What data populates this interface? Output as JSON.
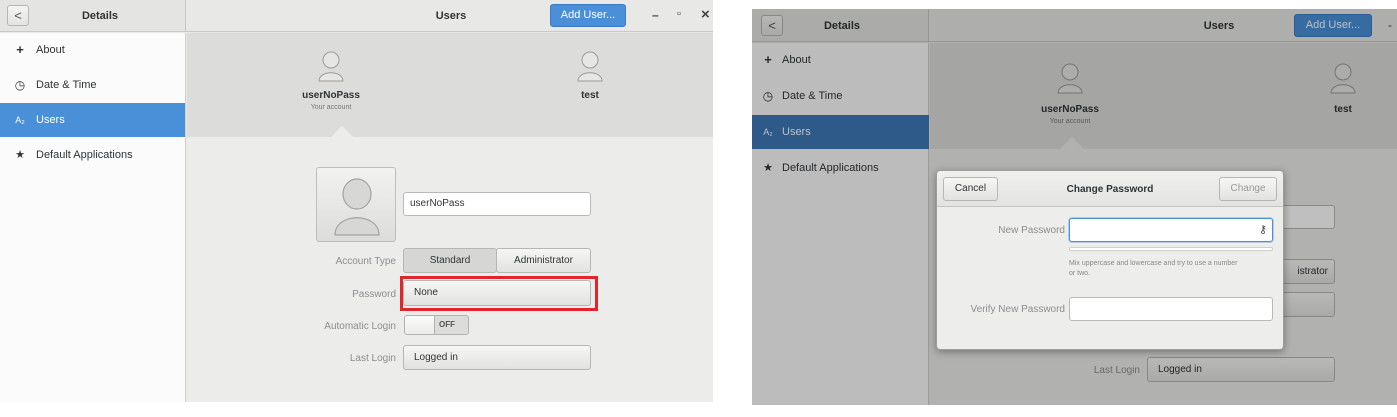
{
  "window1": {
    "header": {
      "back_symbol": "<",
      "left_title": "Details",
      "title": "Users",
      "add_button": "Add User...",
      "minimize": "–",
      "maximize": "▫",
      "close": "×"
    },
    "sidebar": {
      "items": [
        {
          "label": "About",
          "icon": "plus-icon",
          "glyph": "+"
        },
        {
          "label": "Date & Time",
          "icon": "clock-icon",
          "glyph": "◷"
        },
        {
          "label": "Users",
          "icon": "users-icon",
          "glyph": "A₂",
          "selected": true
        },
        {
          "label": "Default Applications",
          "icon": "star-icon",
          "glyph": "★"
        }
      ]
    },
    "accounts": [
      {
        "name": "userNoPass",
        "sub": "Your account"
      },
      {
        "name": "test",
        "sub": ""
      }
    ],
    "form": {
      "username_value": "userNoPass",
      "account_type_label": "Account Type",
      "account_type_options": [
        "Standard",
        "Administrator"
      ],
      "password_label": "Password",
      "password_value": "None",
      "auto_login_label": "Automatic Login",
      "auto_login_state": "OFF",
      "last_login_label": "Last Login",
      "last_login_value": "Logged in"
    },
    "highlight_color": "#e0262d"
  },
  "window2": {
    "header": {
      "back_symbol": "<",
      "left_title": "Details",
      "title": "Users",
      "add_button": "Add User..."
    },
    "sidebar": {
      "items": [
        {
          "label": "About",
          "glyph": "+"
        },
        {
          "label": "Date & Time",
          "glyph": "◷"
        },
        {
          "label": "Users",
          "glyph": "A₂",
          "selected": true
        },
        {
          "label": "Default Applications",
          "glyph": "★"
        }
      ]
    },
    "accounts": [
      {
        "name": "userNoPass",
        "sub": "Your account"
      },
      {
        "name": "test",
        "sub": ""
      }
    ],
    "bg_partial": {
      "admin_fragment": "istrator",
      "last_login_label": "Last Login",
      "last_login_value": "Logged in"
    },
    "dialog": {
      "cancel": "Cancel",
      "title": "Change Password",
      "change": "Change",
      "new_password_label": "New Password",
      "new_password_value": "",
      "hint": "Mix uppercase and lowercase and try to use a number or two.",
      "verify_label": "Verify New Password",
      "verify_value": "",
      "generate_glyph": "⚷"
    }
  },
  "colors": {
    "accent": "#4a90d9",
    "sidebar_selected": "#4a90d9"
  }
}
